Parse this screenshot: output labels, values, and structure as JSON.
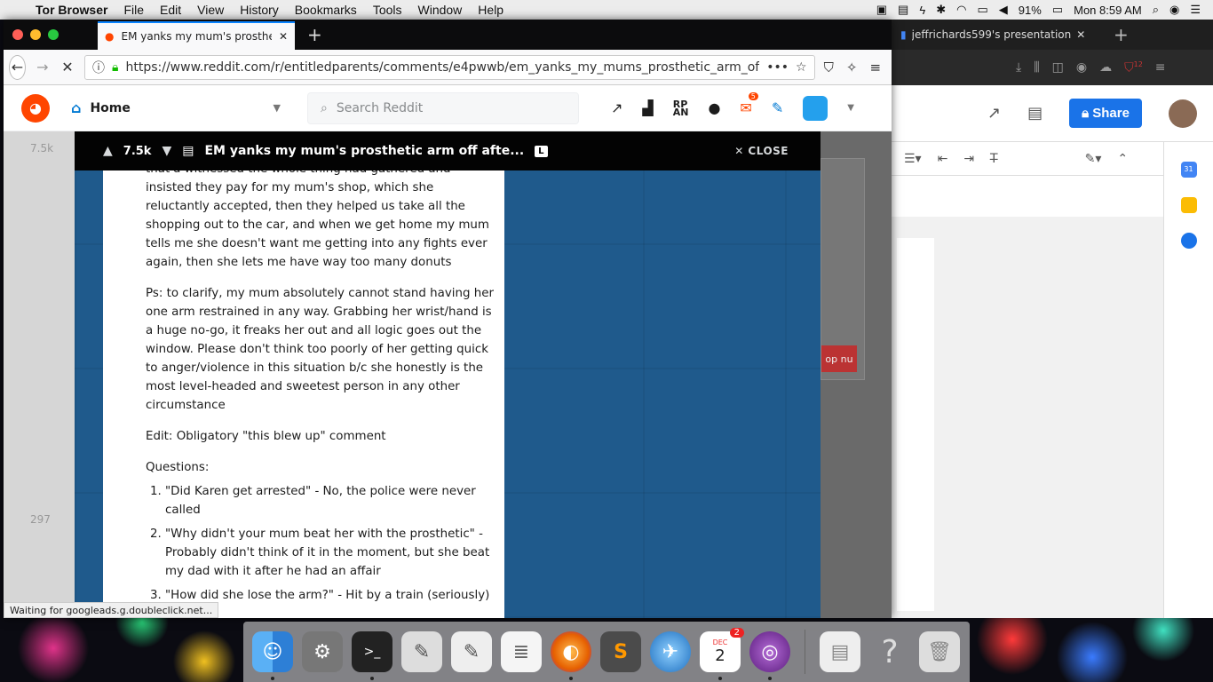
{
  "menubar": {
    "app": "Tor Browser",
    "menus": [
      "File",
      "Edit",
      "View",
      "History",
      "Bookmarks",
      "Tools",
      "Window",
      "Help"
    ],
    "battery": "91%",
    "clock": "Mon 8:59 AM"
  },
  "browser": {
    "tab_title": "EM yanks my mum's prosthetic",
    "url": "https://www.reddit.com/r/entitledparents/comments/e4pwwb/em_yanks_my_mums_prosthetic_arm_of",
    "status": "Waiting for googleads.g.doubleclick.net..."
  },
  "reddit": {
    "home_label": "Home",
    "search_placeholder": "Search Reddit",
    "notif_count": "5",
    "post": {
      "votes": "7.5k",
      "title": "EM yanks my mum's prosthetic arm off afte...",
      "flair": "L",
      "close_label": "CLOSE",
      "paragraphs": [
        "that'd witnessed the whole thing had gathered and insisted they pay for my mum's shop, which she reluctantly accepted, then they helped us take all the shopping out to the car, and when we get home my mum tells me she doesn't want me getting into any fights ever again, then she lets me have way too many donuts",
        "Ps: to clarify, my mum absolutely cannot stand having her one arm restrained in any way. Grabbing her wrist/hand is a huge no-go, it freaks her out and all logic goes out the window. Please don't think too poorly of her getting quick to anger/violence in this situation b/c she honestly is the most level-headed and sweetest person in any other circumstance",
        "Edit: Obligatory \"this blew up\" comment",
        "Questions:"
      ],
      "questions": [
        "\"Did Karen get arrested\" - No, the police were never called",
        "\"Why didn't your mum beat her with the prosthetic\" - Probably didn't think of it in the moment, but she beat my dad with it after he had an affair",
        "\"How did she lose the arm?\" - Hit by a train (seriously)"
      ]
    },
    "under_votes": [
      "7.5k",
      "297"
    ]
  },
  "bg_window": {
    "tab_title": "jeffrichards599's presentation",
    "share_label": "Share",
    "ad_cta": "op nu",
    "calendar_day": "31",
    "ext_count": "12"
  },
  "dock": {
    "calendar_month": "DEC",
    "calendar_day": "2",
    "calendar_badge": "2"
  }
}
